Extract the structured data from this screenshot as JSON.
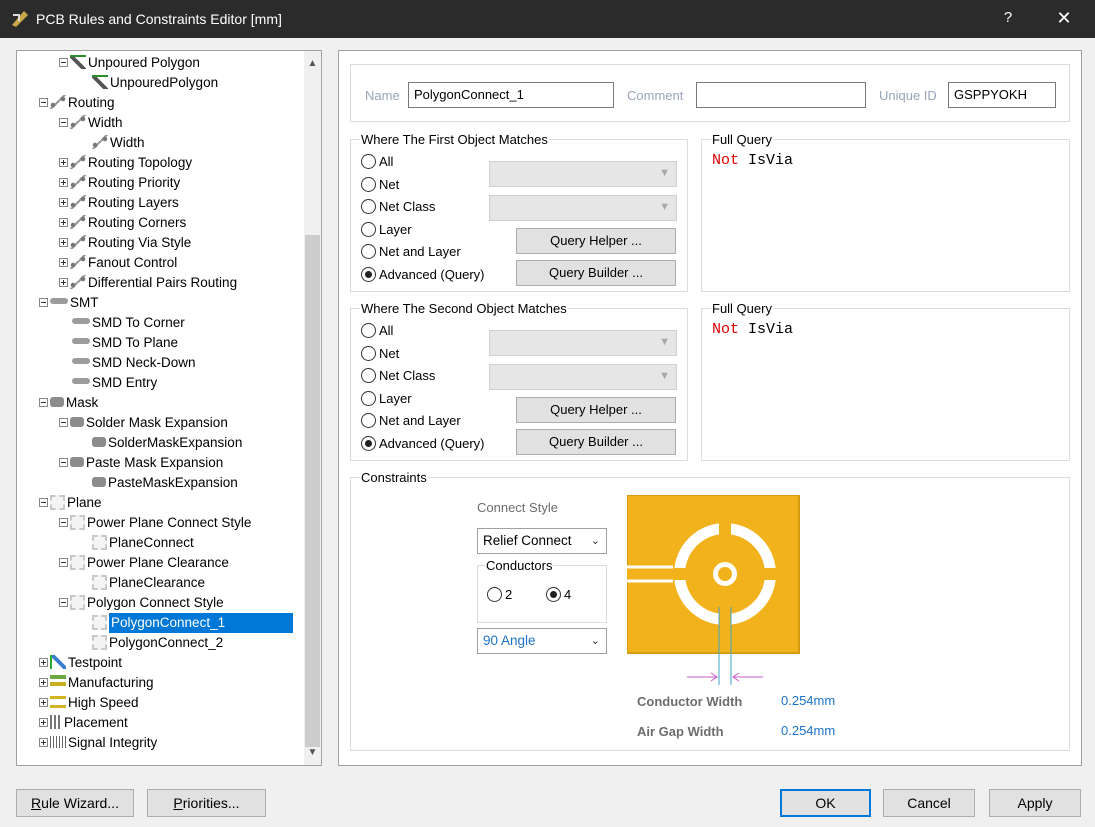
{
  "window": {
    "title": "PCB Rules and Constraints Editor [mm]",
    "help_label": "?",
    "close_label": "✕"
  },
  "tree": {
    "items": [
      {
        "label": "Unpoured Polygon",
        "depth": 1,
        "exp": "minus",
        "icon": "polygon-icon"
      },
      {
        "label": "UnpouredPolygon",
        "depth": 2,
        "exp": "",
        "icon": "polygon-icon"
      },
      {
        "label": "Routing",
        "depth": 0,
        "exp": "minus",
        "icon": "routing-icon"
      },
      {
        "label": "Width",
        "depth": 1,
        "exp": "minus",
        "icon": "routing-icon"
      },
      {
        "label": "Width",
        "depth": 2,
        "exp": "",
        "icon": "routing-icon"
      },
      {
        "label": "Routing Topology",
        "depth": 1,
        "exp": "plus",
        "icon": "routing-icon"
      },
      {
        "label": "Routing Priority",
        "depth": 1,
        "exp": "plus",
        "icon": "routing-icon"
      },
      {
        "label": "Routing Layers",
        "depth": 1,
        "exp": "plus",
        "icon": "routing-icon"
      },
      {
        "label": "Routing Corners",
        "depth": 1,
        "exp": "plus",
        "icon": "routing-icon"
      },
      {
        "label": "Routing Via Style",
        "depth": 1,
        "exp": "plus",
        "icon": "routing-icon"
      },
      {
        "label": "Fanout Control",
        "depth": 1,
        "exp": "plus",
        "icon": "routing-icon"
      },
      {
        "label": "Differential Pairs Routing",
        "depth": 1,
        "exp": "plus",
        "icon": "routing-icon"
      },
      {
        "label": "SMT",
        "depth": 0,
        "exp": "minus",
        "icon": "smt-icon"
      },
      {
        "label": "SMD To Corner",
        "depth": 1,
        "exp": "",
        "icon": "smt-icon"
      },
      {
        "label": "SMD To Plane",
        "depth": 1,
        "exp": "",
        "icon": "smt-icon"
      },
      {
        "label": "SMD Neck-Down",
        "depth": 1,
        "exp": "",
        "icon": "smt-icon"
      },
      {
        "label": "SMD Entry",
        "depth": 1,
        "exp": "",
        "icon": "smt-icon"
      },
      {
        "label": "Mask",
        "depth": 0,
        "exp": "minus",
        "icon": "mask-icon"
      },
      {
        "label": "Solder Mask Expansion",
        "depth": 1,
        "exp": "minus",
        "icon": "mask-icon"
      },
      {
        "label": "SolderMaskExpansion",
        "depth": 2,
        "exp": "",
        "icon": "mask-icon"
      },
      {
        "label": "Paste Mask Expansion",
        "depth": 1,
        "exp": "minus",
        "icon": "mask-icon"
      },
      {
        "label": "PasteMaskExpansion",
        "depth": 2,
        "exp": "",
        "icon": "mask-icon"
      },
      {
        "label": "Plane",
        "depth": 0,
        "exp": "minus",
        "icon": "plane-icon"
      },
      {
        "label": "Power Plane Connect Style",
        "depth": 1,
        "exp": "minus",
        "icon": "plane-icon"
      },
      {
        "label": "PlaneConnect",
        "depth": 2,
        "exp": "",
        "icon": "plane-icon"
      },
      {
        "label": "Power Plane Clearance",
        "depth": 1,
        "exp": "minus",
        "icon": "plane-icon"
      },
      {
        "label": "PlaneClearance",
        "depth": 2,
        "exp": "",
        "icon": "plane-icon"
      },
      {
        "label": "Polygon Connect Style",
        "depth": 1,
        "exp": "minus",
        "icon": "plane-icon"
      },
      {
        "label": "PolygonConnect_1",
        "depth": 2,
        "exp": "",
        "icon": "plane-icon",
        "selected": true
      },
      {
        "label": "PolygonConnect_2",
        "depth": 2,
        "exp": "",
        "icon": "plane-icon"
      },
      {
        "label": "Testpoint",
        "depth": 0,
        "exp": "plus",
        "icon": "testpoint-icon"
      },
      {
        "label": "Manufacturing",
        "depth": 0,
        "exp": "plus",
        "icon": "manufacturing-icon"
      },
      {
        "label": "High Speed",
        "depth": 0,
        "exp": "plus",
        "icon": "high-speed-icon"
      },
      {
        "label": "Placement",
        "depth": 0,
        "exp": "plus",
        "icon": "placement-icon"
      },
      {
        "label": "Signal Integrity",
        "depth": 0,
        "exp": "plus",
        "icon": "signal-integrity-icon"
      }
    ]
  },
  "rule": {
    "name_label": "Name",
    "name_value": "PolygonConnect_1",
    "comment_label": "Comment",
    "comment_value": "",
    "uid_label": "Unique ID",
    "uid_value": "GSPPYOKH"
  },
  "first_match": {
    "title": "Where The First Object Matches",
    "options": [
      "All",
      "Net",
      "Net Class",
      "Layer",
      "Net and Layer",
      "Advanced (Query)"
    ],
    "selected": "Advanced (Query)",
    "query_helper_label": "Query Helper ...",
    "query_builder_label": "Query Builder ...",
    "full_query_title": "Full Query",
    "query_keyword": "Not",
    "query_rest": " IsVia"
  },
  "second_match": {
    "title": "Where The Second Object Matches",
    "options": [
      "All",
      "Net",
      "Net Class",
      "Layer",
      "Net and Layer",
      "Advanced (Query)"
    ],
    "selected": "Advanced (Query)",
    "query_helper_label": "Query Helper ...",
    "query_builder_label": "Query Builder ...",
    "full_query_title": "Full Query",
    "query_keyword": "Not",
    "query_rest": " IsVia"
  },
  "constraints": {
    "title": "Constraints",
    "connect_style_label": "Connect Style",
    "connect_style_value": "Relief Connect",
    "conductors_title": "Conductors",
    "conductor_options": [
      "2",
      "4"
    ],
    "conductors_selected": "4",
    "angle_value": "90 Angle",
    "conductor_width_label": "Conductor Width",
    "conductor_width_value": "0.254mm",
    "air_gap_label": "Air Gap Width",
    "air_gap_value": "0.254mm",
    "colors": {
      "copper": "#f2b21c",
      "hole": "#ffffff",
      "dimension": "#c85ac8",
      "link": "#1d73c9"
    }
  },
  "footer": {
    "rule_wizard_label": "Rule Wizard...",
    "priorities_label": "Priorities...",
    "ok_label": "OK",
    "cancel_label": "Cancel",
    "apply_label": "Apply"
  }
}
